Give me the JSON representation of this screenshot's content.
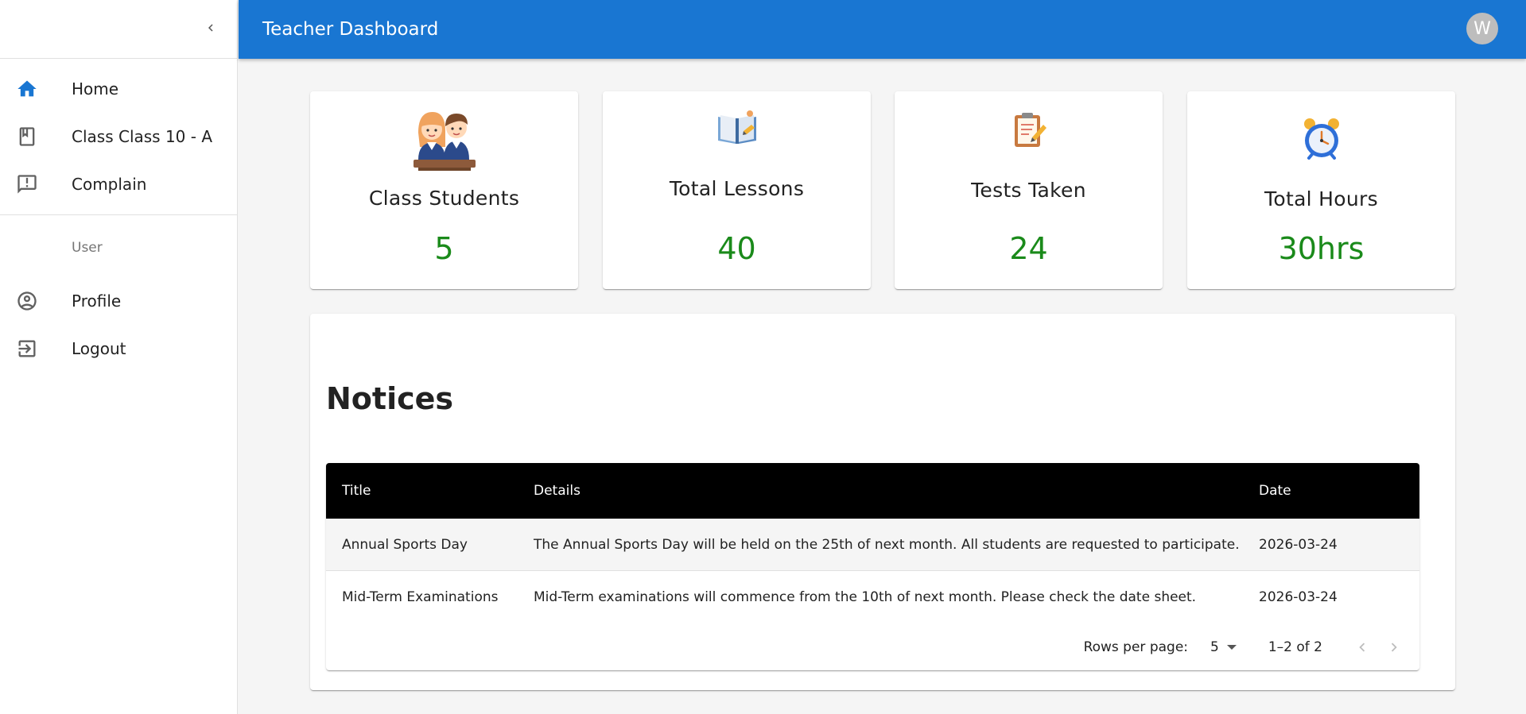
{
  "appbar": {
    "title": "Teacher Dashboard",
    "avatar_initial": "W"
  },
  "sidebar": {
    "items": [
      {
        "label": "Home",
        "icon": "home-icon",
        "active": true
      },
      {
        "label": "Class Class 10 - A",
        "icon": "class-book-icon"
      },
      {
        "label": "Complain",
        "icon": "announcement-icon"
      }
    ],
    "subheader": "User",
    "user_items": [
      {
        "label": "Profile",
        "icon": "account-circle-icon"
      },
      {
        "label": "Logout",
        "icon": "exit-icon"
      }
    ]
  },
  "stats": [
    {
      "title": "Class Students",
      "value": "5",
      "icon": "students-illustration"
    },
    {
      "title": "Total Lessons",
      "value": "40",
      "icon": "open-book-illustration"
    },
    {
      "title": "Tests Taken",
      "value": "24",
      "icon": "clipboard-illustration"
    },
    {
      "title": "Total Hours",
      "value": "30hrs",
      "icon": "alarm-clock-illustration"
    }
  ],
  "notices": {
    "title": "Notices",
    "columns": [
      "Title",
      "Details",
      "Date"
    ],
    "rows": [
      {
        "title": "Annual Sports Day",
        "details": "The Annual Sports Day will be held on the 25th of next month. All students are requested to participate.",
        "date": "2026-03-24"
      },
      {
        "title": "Mid-Term Examinations",
        "details": "Mid-Term examinations will commence from the 10th of next month. Please check the date sheet.",
        "date": "2026-03-24"
      }
    ],
    "pagination": {
      "rows_per_page_label": "Rows per page:",
      "rows_per_page": "5",
      "range": "1–2 of 2"
    }
  },
  "colors": {
    "primary": "#1976d2",
    "stat_value": "#1a8a1a",
    "table_header": "#000000"
  }
}
